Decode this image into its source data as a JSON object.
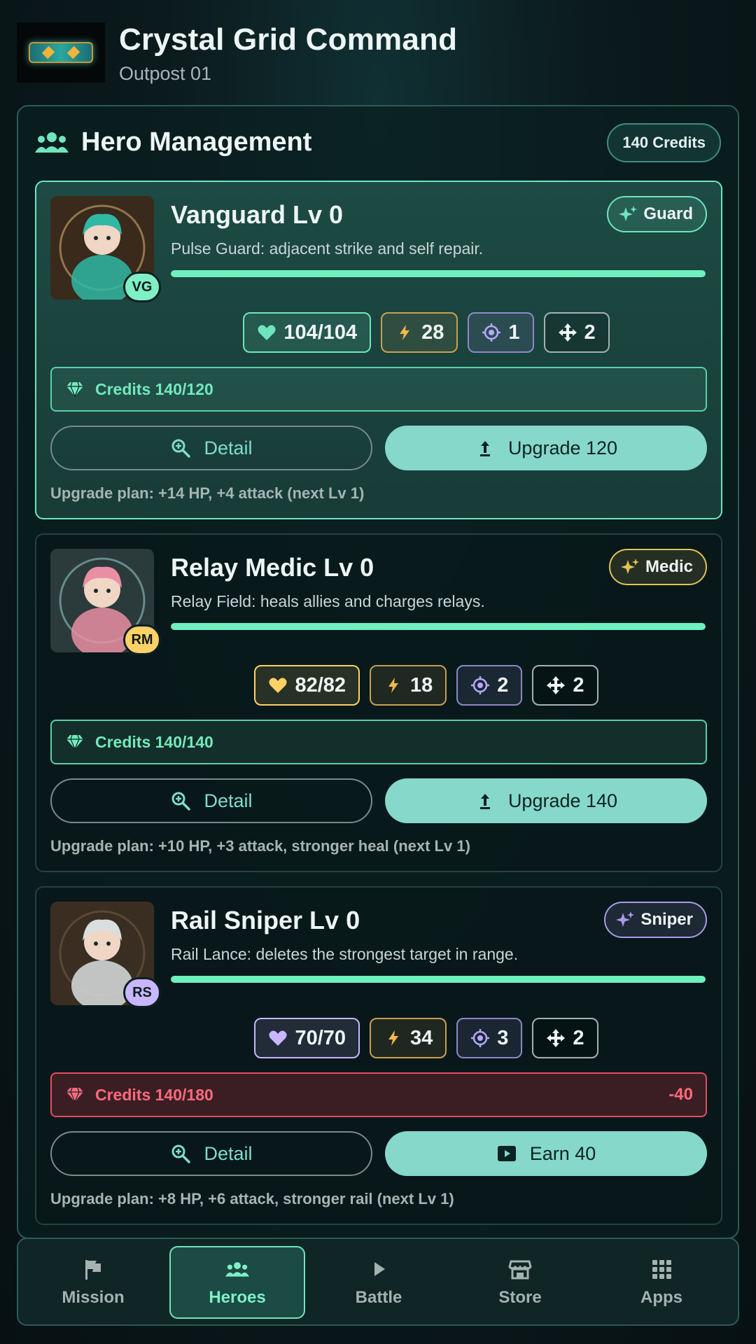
{
  "app": {
    "title": "Crystal Grid Command",
    "subtitle": "Outpost 01",
    "logo_icon": "crystal-grid-logo"
  },
  "panel": {
    "title": "Hero Management",
    "icon": "users-icon",
    "credits_label": "140 Credits"
  },
  "colors": {
    "accent": "#6ff0bf",
    "button": "#86d8cb",
    "danger": "#ff6a7c",
    "panel_border": "#2b5b57"
  },
  "heroes": [
    {
      "name": "Vanguard Lv 0",
      "initials": "VG",
      "initials_color": "#7ff0c5",
      "role": "Guard",
      "role_color": "#6fe5bd",
      "description": "Pulse Guard: adjacent strike and self repair.",
      "xp_fraction": 1.0,
      "stats": {
        "hp": "104/104",
        "attack": "28",
        "range": "1",
        "move": "2"
      },
      "hp_color": "#6fe5bd",
      "credits": "Credits 140/120",
      "credits_short": false,
      "deficit": "",
      "detail_label": "Detail",
      "action_label": "Upgrade 120",
      "action_icon": "upload-icon",
      "plan": "Upgrade plan: +14 HP, +4 attack (next Lv 1)",
      "active": true
    },
    {
      "name": "Relay Medic Lv 0",
      "initials": "RM",
      "initials_color": "#ffd166",
      "role": "Medic",
      "role_color": "#e1c25a",
      "description": "Relay Field: heals allies and charges relays.",
      "xp_fraction": 1.0,
      "stats": {
        "hp": "82/82",
        "attack": "18",
        "range": "2",
        "move": "2"
      },
      "hp_color": "#ffd166",
      "credits": "Credits 140/140",
      "credits_short": false,
      "deficit": "",
      "detail_label": "Detail",
      "action_label": "Upgrade 140",
      "action_icon": "upload-icon",
      "plan": "Upgrade plan: +10 HP, +3 attack, stronger heal (next Lv 1)",
      "active": false
    },
    {
      "name": "Rail Sniper Lv 0",
      "initials": "RS",
      "initials_color": "#c8b6ff",
      "role": "Sniper",
      "role_color": "#a99be8",
      "description": "Rail Lance: deletes the strongest target in range.",
      "xp_fraction": 1.0,
      "stats": {
        "hp": "70/70",
        "attack": "34",
        "range": "3",
        "move": "2"
      },
      "hp_color": "#c8b6ff",
      "credits": "Credits 140/180",
      "credits_short": true,
      "deficit": "-40",
      "detail_label": "Detail",
      "action_label": "Earn 40",
      "action_icon": "play-video-icon",
      "plan": "Upgrade plan: +8 HP, +6 attack, stronger rail (next Lv 1)",
      "active": false
    }
  ],
  "nav": [
    {
      "label": "Mission",
      "icon": "flag-icon",
      "active": false
    },
    {
      "label": "Heroes",
      "icon": "users-icon",
      "active": true
    },
    {
      "label": "Battle",
      "icon": "play-icon",
      "active": false
    },
    {
      "label": "Store",
      "icon": "store-icon",
      "active": false
    },
    {
      "label": "Apps",
      "icon": "grid-icon",
      "active": false
    }
  ]
}
